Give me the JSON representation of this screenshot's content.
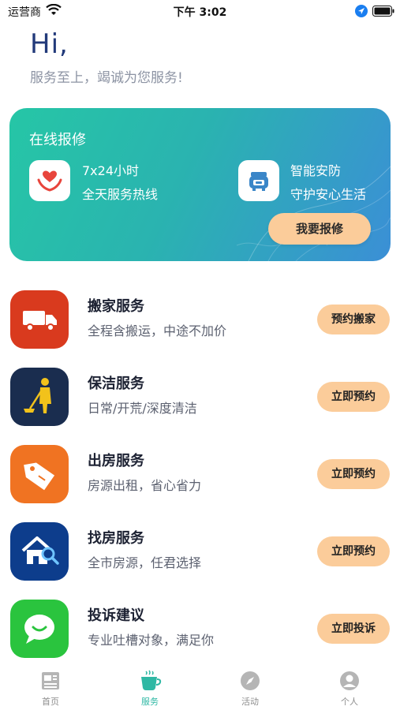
{
  "status_bar": {
    "carrier": "运营商",
    "time": "下午 3:02"
  },
  "greeting": {
    "hello": "Hi,",
    "slogan": "服务至上，竭诚为您服务!"
  },
  "banner": {
    "title": "在线报修",
    "feature_left": {
      "icon": "heart-hands-icon",
      "line1": "7x24小时",
      "line2": "全天服务热线"
    },
    "feature_right": {
      "icon": "security-guard-icon",
      "line1": "智能安防",
      "line2": "守护安心生活"
    },
    "button_label": "我要报修"
  },
  "services": [
    {
      "title": "搬家服务",
      "desc": "全程含搬运，中途不加价",
      "button": "预约搬家",
      "icon": "truck-icon",
      "icon_bg": "#d93a1e"
    },
    {
      "title": "保洁服务",
      "desc": "日常/开荒/深度清洁",
      "button": "立即预约",
      "icon": "cleaner-icon",
      "icon_bg": "#1a2d4f"
    },
    {
      "title": "出房服务",
      "desc": "房源出租，省心省力",
      "button": "立即预约",
      "icon": "tag-icon",
      "icon_bg": "#f07322"
    },
    {
      "title": "找房服务",
      "desc": "全市房源，任君选择",
      "button": "立即预约",
      "icon": "house-search-icon",
      "icon_bg": "#0d3d8c"
    },
    {
      "title": "投诉建议",
      "desc": "专业吐槽对象，满足你",
      "button": "立即投诉",
      "icon": "chat-bubble-icon",
      "icon_bg": "#2ac43e"
    }
  ],
  "tab_bar": [
    {
      "label": "首页",
      "icon": "newspaper-icon",
      "active": false
    },
    {
      "label": "服务",
      "icon": "coffee-cup-icon",
      "active": true
    },
    {
      "label": "活动",
      "icon": "compass-icon",
      "active": false
    },
    {
      "label": "个人",
      "icon": "user-icon",
      "active": false
    }
  ],
  "colors": {
    "accent": "#2fb8a4",
    "button": "#fbcc9a",
    "title": "#223a7a"
  }
}
